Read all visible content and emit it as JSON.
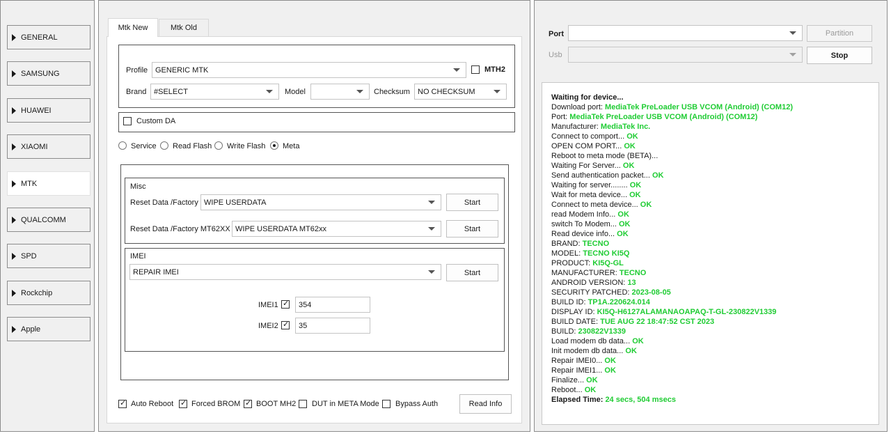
{
  "nav": {
    "items": [
      {
        "label": "GENERAL"
      },
      {
        "label": "SAMSUNG"
      },
      {
        "label": "HUAWEI"
      },
      {
        "label": "XIAOMI"
      },
      {
        "label": "MTK"
      },
      {
        "label": "QUALCOMM"
      },
      {
        "label": "SPD"
      },
      {
        "label": "Rockchip"
      },
      {
        "label": "Apple"
      }
    ],
    "active": "MTK"
  },
  "tabs": [
    {
      "label": "Mtk New"
    },
    {
      "label": "Mtk Old"
    }
  ],
  "device": {
    "profile_label": "Profile",
    "profile_value": "GENERIC MTK",
    "mth2_label": "MTH2",
    "brand_label": "Brand",
    "brand_value": "#SELECT",
    "model_label": "Model",
    "model_value": "",
    "checksum_label": "Checksum",
    "checksum_value": "NO CHECKSUM"
  },
  "custom_da": {
    "label": "Custom DA"
  },
  "modes": [
    {
      "label": "Service"
    },
    {
      "label": "Read Flash"
    },
    {
      "label": "Write Flash"
    },
    {
      "label": "Meta"
    }
  ],
  "misc": {
    "title": "Misc",
    "row1_label": "Reset Data /Factory",
    "row1_value": "WIPE USERDATA",
    "row2_label": "Reset Data /Factory MT62XX",
    "row2_value": "WIPE USERDATA MT62xx",
    "start_label": "Start"
  },
  "imei": {
    "title": "IMEI",
    "action_value": "REPAIR IMEI",
    "start_label": "Start",
    "imei1_label": "IMEI1",
    "imei1_value": "354",
    "imei2_label": "IMEI2",
    "imei2_value": "35"
  },
  "options": [
    {
      "label": "Auto Reboot"
    },
    {
      "label": "Forced BROM"
    },
    {
      "label": "BOOT MH2"
    },
    {
      "label": "DUT in META Mode"
    },
    {
      "label": "Bypass Auth"
    }
  ],
  "read_info_label": "Read Info",
  "port": {
    "port_label": "Port",
    "usb_label": "Usb",
    "partition_label": "Partition",
    "stop_label": "Stop"
  },
  "log": [
    {
      "k": "Waiting for device...",
      "v": "",
      "bold": true
    },
    {
      "k": "Download port: ",
      "v": "MediaTek PreLoader USB VCOM (Android) (COM12)"
    },
    {
      "k": "Port: ",
      "v": "MediaTek PreLoader USB VCOM (Android) (COM12)"
    },
    {
      "k": "Manufacturer: ",
      "v": "MediaTek Inc."
    },
    {
      "k": "Connect to comport... ",
      "v": "OK"
    },
    {
      "k": "OPEN COM PORT... ",
      "v": "OK"
    },
    {
      "k": "Reboot to meta mode (BETA)...",
      "v": ""
    },
    {
      "k": "Waiting For Server... ",
      "v": "OK"
    },
    {
      "k": "Send authentication packet... ",
      "v": "OK"
    },
    {
      "k": "Waiting for server........ ",
      "v": "OK"
    },
    {
      "k": "Wait for meta device... ",
      "v": "OK"
    },
    {
      "k": "Connect to meta device... ",
      "v": "OK"
    },
    {
      "k": "read Modem Info... ",
      "v": "OK"
    },
    {
      "k": "switch To Modem... ",
      "v": "OK"
    },
    {
      "k": "Read device info... ",
      "v": "OK"
    },
    {
      "k": " BRAND: ",
      "v": "TECNO"
    },
    {
      "k": " MODEL: ",
      "v": "TECNO KI5Q"
    },
    {
      "k": " PRODUCT: ",
      "v": "KI5Q-GL"
    },
    {
      "k": " MANUFACTURER: ",
      "v": "TECNO"
    },
    {
      "k": " ANDROID VERSION: ",
      "v": "13"
    },
    {
      "k": " SECURITY PATCHED: ",
      "v": "2023-08-05"
    },
    {
      "k": " BUILD ID: ",
      "v": "TP1A.220624.014"
    },
    {
      "k": " DISPLAY ID: ",
      "v": "KI5Q-H6127ALAMANAOAPAQ-T-GL-230822V1339"
    },
    {
      "k": " BUILD DATE: ",
      "v": "TUE AUG 22 18:47:52 CST 2023"
    },
    {
      "k": " BUILD: ",
      "v": "230822V1339"
    },
    {
      "k": "Load modem db data... ",
      "v": "OK"
    },
    {
      "k": "Init modem db data... ",
      "v": "OK"
    },
    {
      "k": "Repair IMEI0... ",
      "v": "OK"
    },
    {
      "k": "Repair IMEI1... ",
      "v": "OK"
    },
    {
      "k": "Finalize... ",
      "v": "OK"
    },
    {
      "k": "Reboot... ",
      "v": "OK"
    },
    {
      "k": "Elapsed Time: ",
      "v": "24 secs, 504 msecs",
      "bold": true
    }
  ],
  "colors": {
    "ok": "#1fcc33",
    "panel": "#f0f0f0"
  }
}
